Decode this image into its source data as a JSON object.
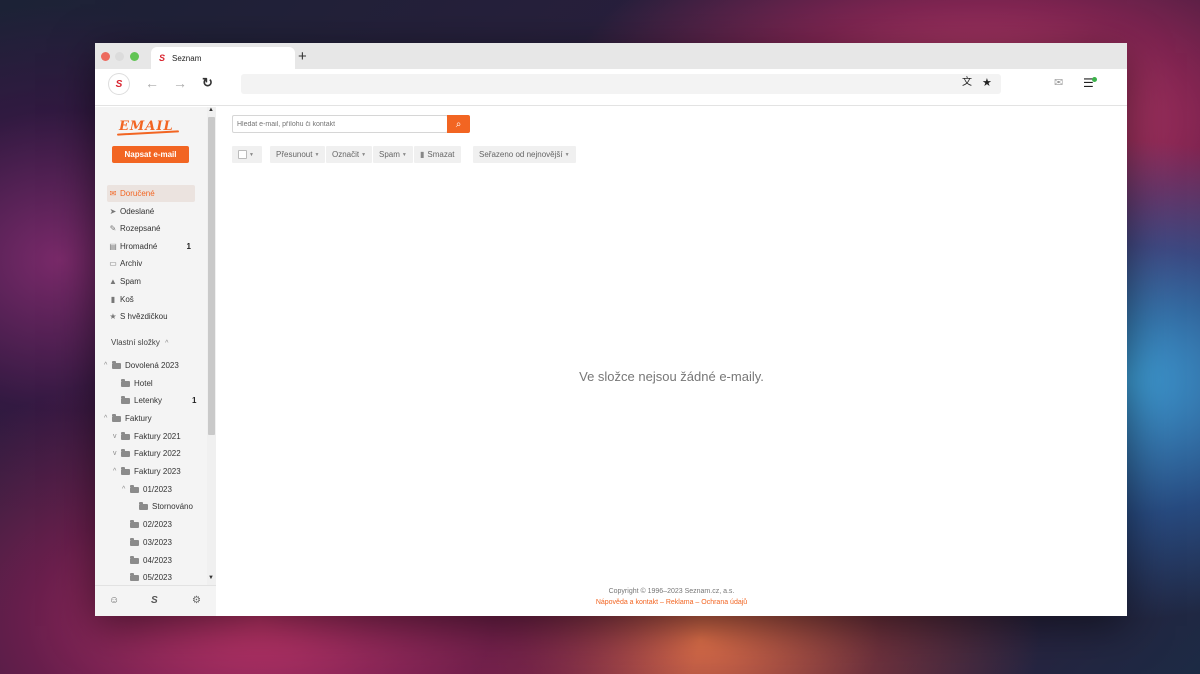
{
  "browser": {
    "tab_title": "Seznam",
    "new_tab": "+",
    "back": "←",
    "forward": "→",
    "reload": "↻"
  },
  "logo": "EMAIL",
  "compose_label": "Napsat e-mail",
  "folders": [
    {
      "label": "Doručené",
      "icon": "inbox-icon",
      "glyph": "✉",
      "count": ""
    },
    {
      "label": "Odeslané",
      "icon": "send-icon",
      "glyph": "➤",
      "count": ""
    },
    {
      "label": "Rozepsané",
      "icon": "draft-icon",
      "glyph": "✎",
      "count": ""
    },
    {
      "label": "Hromadné",
      "icon": "bulk-icon",
      "glyph": "▤",
      "count": "1"
    },
    {
      "label": "Archiv",
      "icon": "archive-icon",
      "glyph": "▭",
      "count": ""
    },
    {
      "label": "Spam",
      "icon": "spam-icon",
      "glyph": "▲",
      "count": ""
    },
    {
      "label": "Koš",
      "icon": "trash-icon",
      "glyph": "▮",
      "count": ""
    },
    {
      "label": "S hvězdičkou",
      "icon": "star-icon",
      "glyph": "★",
      "count": ""
    }
  ],
  "custom_folders_title": "Vlastní složky",
  "custom_folders_caret": "^",
  "tree": [
    {
      "label": "Dovolená 2023",
      "chev": "^",
      "count": ""
    },
    {
      "label": "Hotel",
      "chev": "",
      "count": ""
    },
    {
      "label": "Letenky",
      "chev": "",
      "count": "1"
    },
    {
      "label": "Faktury",
      "chev": "^",
      "count": ""
    },
    {
      "label": "Faktury 2021",
      "chev": "v",
      "count": ""
    },
    {
      "label": "Faktury 2022",
      "chev": "v",
      "count": ""
    },
    {
      "label": "Faktury 2023",
      "chev": "^",
      "count": ""
    },
    {
      "label": "01/2023",
      "chev": "^",
      "count": ""
    },
    {
      "label": "Stornováno",
      "chev": "",
      "count": ""
    },
    {
      "label": "02/2023",
      "chev": "",
      "count": ""
    },
    {
      "label": "03/2023",
      "chev": "",
      "count": ""
    },
    {
      "label": "04/2023",
      "chev": "",
      "count": ""
    },
    {
      "label": "05/2023",
      "chev": "",
      "count": ""
    }
  ],
  "search": {
    "placeholder": "Hledat e-mail, přílohu či kontakt"
  },
  "actions": {
    "move": "Přesunout",
    "mark": "Označit",
    "spam": "Spam",
    "delete": "Smazat",
    "sort": "Seřazeno od nejnovější"
  },
  "empty_message": "Ve složce nejsou žádné e-maily.",
  "footer": {
    "copyright": "Copyright © 1996–2023 Seznam.cz, a.s.",
    "links": "Nápověda a kontakt – Reklama – Ochrana údajů"
  },
  "colors": {
    "accent": "#f26522"
  }
}
